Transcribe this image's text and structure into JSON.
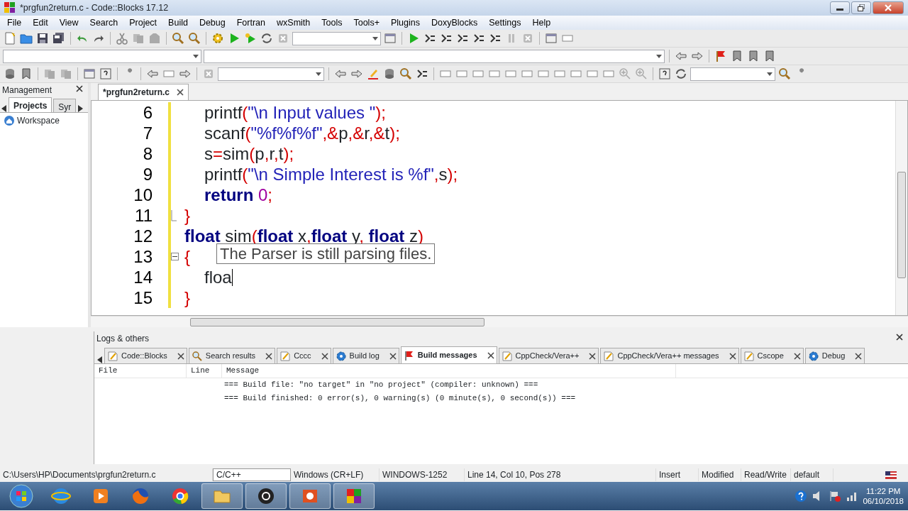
{
  "window": {
    "title": "*prgfun2return.c - Code::Blocks 17.12"
  },
  "menu": [
    "File",
    "Edit",
    "View",
    "Search",
    "Project",
    "Build",
    "Debug",
    "Fortran",
    "wxSmith",
    "Tools",
    "Tools+",
    "Plugins",
    "DoxyBlocks",
    "Settings",
    "Help"
  ],
  "management": {
    "title": "Management",
    "tabs": [
      {
        "label": "Projects",
        "selected": true
      },
      {
        "label": "Syr",
        "selected": false
      }
    ],
    "tree": [
      {
        "label": "Workspace"
      }
    ]
  },
  "editor": {
    "tabs": [
      {
        "label": "*prgfun2return.c",
        "selected": true
      }
    ],
    "lines": [
      {
        "number": "6",
        "indented": true,
        "tokens": [
          {
            "kind": "plain",
            "text": "printf"
          },
          {
            "kind": "op",
            "text": "("
          },
          {
            "kind": "str",
            "text": "\"\\n Input values \""
          },
          {
            "kind": "op",
            "text": ");"
          }
        ]
      },
      {
        "number": "7",
        "indented": true,
        "tokens": [
          {
            "kind": "plain",
            "text": "scanf"
          },
          {
            "kind": "op",
            "text": "("
          },
          {
            "kind": "str",
            "text": "\"%f%f%f\""
          },
          {
            "kind": "op",
            "text": ",&"
          },
          {
            "kind": "plain",
            "text": "p"
          },
          {
            "kind": "op",
            "text": ",&"
          },
          {
            "kind": "plain",
            "text": "r"
          },
          {
            "kind": "op",
            "text": ",&"
          },
          {
            "kind": "plain",
            "text": "t"
          },
          {
            "kind": "op",
            "text": ");"
          }
        ]
      },
      {
        "number": "8",
        "indented": true,
        "tokens": [
          {
            "kind": "plain",
            "text": "s"
          },
          {
            "kind": "op",
            "text": "="
          },
          {
            "kind": "plain",
            "text": "sim"
          },
          {
            "kind": "op",
            "text": "("
          },
          {
            "kind": "plain",
            "text": "p"
          },
          {
            "kind": "op",
            "text": ","
          },
          {
            "kind": "plain",
            "text": "r"
          },
          {
            "kind": "op",
            "text": ","
          },
          {
            "kind": "plain",
            "text": "t"
          },
          {
            "kind": "op",
            "text": ");"
          }
        ]
      },
      {
        "number": "9",
        "indented": true,
        "tokens": [
          {
            "kind": "plain",
            "text": "printf"
          },
          {
            "kind": "op",
            "text": "("
          },
          {
            "kind": "str",
            "text": "\"\\n Simple Interest is %f\""
          },
          {
            "kind": "op",
            "text": ","
          },
          {
            "kind": "plain",
            "text": "s"
          },
          {
            "kind": "op",
            "text": ");"
          }
        ]
      },
      {
        "number": "10",
        "indented": true,
        "tokens": [
          {
            "kind": "kw",
            "text": "return"
          },
          {
            "kind": "num",
            "text": " 0"
          },
          {
            "kind": "op",
            "text": ";"
          }
        ]
      },
      {
        "number": "11",
        "indented": false,
        "fold_end": true,
        "tokens": [
          {
            "kind": "op",
            "text": "}"
          }
        ]
      },
      {
        "number": "12",
        "indented": false,
        "tokens": [
          {
            "kind": "kw",
            "text": "float"
          },
          {
            "kind": "plain",
            "text": " sim"
          },
          {
            "kind": "op",
            "text": "("
          },
          {
            "kind": "kw",
            "text": "float"
          },
          {
            "kind": "plain",
            "text": " x"
          },
          {
            "kind": "op",
            "text": ","
          },
          {
            "kind": "kw",
            "text": "float"
          },
          {
            "kind": "plain",
            "text": " y"
          },
          {
            "kind": "op",
            "text": ", "
          },
          {
            "kind": "kw",
            "text": "float"
          },
          {
            "kind": "plain",
            "text": " z"
          },
          {
            "kind": "op",
            "text": ")"
          }
        ]
      },
      {
        "number": "13",
        "indented": false,
        "fold_start": true,
        "tokens": [
          {
            "kind": "op",
            "text": "{"
          }
        ]
      },
      {
        "number": "14",
        "indented": true,
        "cursor": true,
        "tokens": [
          {
            "kind": "plain",
            "text": "floa"
          }
        ]
      },
      {
        "number": "15",
        "indented": false,
        "tokens": [
          {
            "kind": "op",
            "text": "}"
          }
        ]
      }
    ],
    "tooltip": "The Parser is still parsing files."
  },
  "logs": {
    "title": "Logs & others",
    "tabs": [
      {
        "label": "Code::Blocks",
        "selected": false,
        "kind": "note"
      },
      {
        "label": "Search results",
        "selected": false,
        "kind": "search"
      },
      {
        "label": "Cccc",
        "selected": false,
        "kind": "note"
      },
      {
        "label": "Build log",
        "selected": false,
        "kind": "gear"
      },
      {
        "label": "Build messages",
        "selected": true,
        "kind": "flag"
      },
      {
        "label": "CppCheck/Vera++",
        "selected": false,
        "kind": "note"
      },
      {
        "label": "CppCheck/Vera++ messages",
        "selected": false,
        "kind": "note"
      },
      {
        "label": "Cscope",
        "selected": false,
        "kind": "note"
      },
      {
        "label": "Debug",
        "selected": false,
        "kind": "gear"
      }
    ],
    "columns": [
      "File",
      "Line",
      "Message"
    ],
    "rows": [
      {
        "message": "=== Build file: \"no target\" in \"no project\" (compiler: unknown) ==="
      },
      {
        "message": "=== Build finished: 0 error(s), 0 warning(s) (0 minute(s), 0 second(s)) ==="
      }
    ]
  },
  "status_bar": [
    "C:\\Users\\HP\\Documents\\prgfun2return.c",
    "C/C++",
    "Windows (CR+LF)",
    "WINDOWS-1252",
    "Line 14, Col 10, Pos 278",
    "Insert",
    "Modified",
    "Read/Write",
    "default"
  ],
  "taskbar": {
    "time": "11:22 PM",
    "date": "06/10/2018"
  }
}
